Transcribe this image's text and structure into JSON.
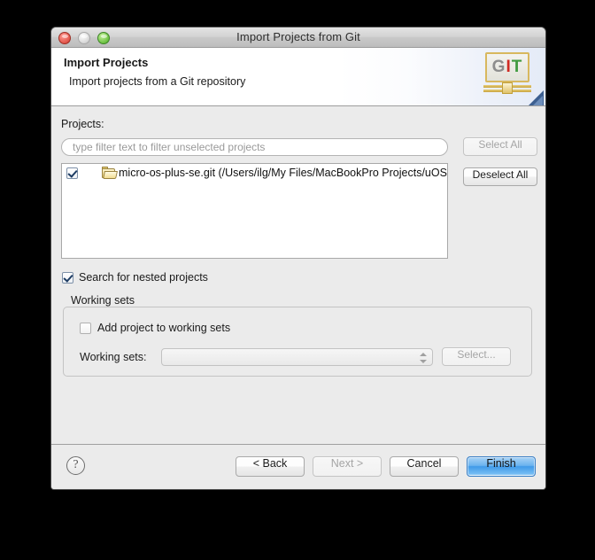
{
  "window": {
    "title": "Import Projects from Git",
    "traffic_lights": [
      "close-button",
      "minimize-button",
      "zoom-button"
    ]
  },
  "header": {
    "title": "Import Projects",
    "subtitle": "Import projects from a Git repository",
    "logo": {
      "letters": [
        "G",
        "I",
        "T"
      ]
    }
  },
  "main": {
    "projects_label": "Projects:",
    "filter": {
      "value": "",
      "placeholder": "type filter text to filter unselected projects"
    },
    "buttons": {
      "select_all": "Select All",
      "deselect_all": "Deselect All"
    },
    "tree": {
      "items": [
        {
          "label": "micro-os-plus-se.git (/Users/ilg/My Files/MacBookPro Projects/uOS/micro-os-plus-se.git)",
          "checked": true,
          "icon": "folder-icon"
        }
      ]
    },
    "nested_checkbox": {
      "label": "Search for nested projects",
      "checked": true
    },
    "working_sets": {
      "group_label": "Working sets",
      "add_checkbox_label": "Add project to working sets",
      "add_checked": false,
      "combo_label": "Working sets:",
      "combo_value": "",
      "select_button": "Select..."
    }
  },
  "footer": {
    "help_glyph": "?",
    "back": "< Back",
    "next": "Next >",
    "cancel": "Cancel",
    "finish": "Finish"
  }
}
